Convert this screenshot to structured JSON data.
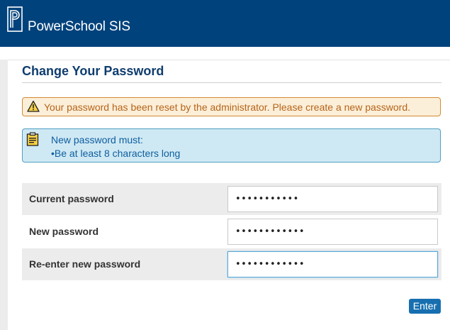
{
  "header": {
    "brand": "PowerSchool SIS",
    "bar_color": "#00427c"
  },
  "page": {
    "title": "Change Your Password"
  },
  "alert": {
    "icon": "warning-icon",
    "text": "Your password has been reset by the administrator. Please create a new password."
  },
  "info": {
    "icon": "clipboard-icon",
    "line1": "New password must:",
    "line2": "•Be at least 8 characters long"
  },
  "form": {
    "fields": [
      {
        "label": "Current password",
        "value_masked": "•••••••••••"
      },
      {
        "label": "New password",
        "value_masked": "••••••••••••"
      },
      {
        "label": "Re-enter new password",
        "value_masked": "••••••••••••"
      }
    ],
    "submit_label": "Enter"
  }
}
